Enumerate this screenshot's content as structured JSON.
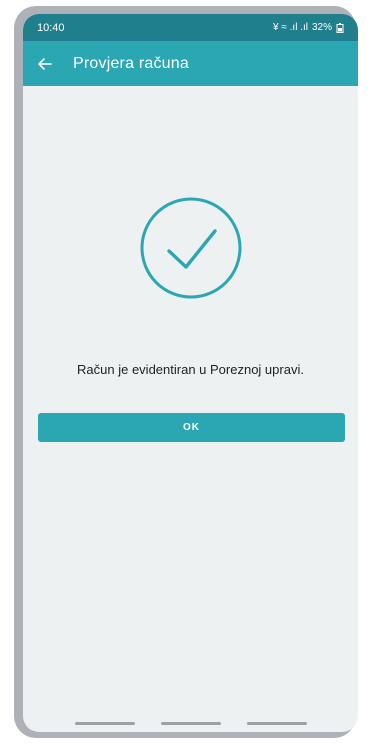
{
  "status": {
    "time": "10:40",
    "indicators": "¥ ≈ .ıl .ıl",
    "battery": "32%"
  },
  "appbar": {
    "title": "Provjera računa"
  },
  "main": {
    "message": "Račun je evidentiran u Poreznoj upravi.",
    "ok_label": "OK"
  },
  "colors": {
    "status_bar": "#1f7f8c",
    "app_bar": "#2aa7b3",
    "background": "#eef1f2",
    "accent": "#2aa7b3"
  },
  "icons": {
    "back": "arrow-left-icon",
    "success": "check-circle-icon"
  }
}
